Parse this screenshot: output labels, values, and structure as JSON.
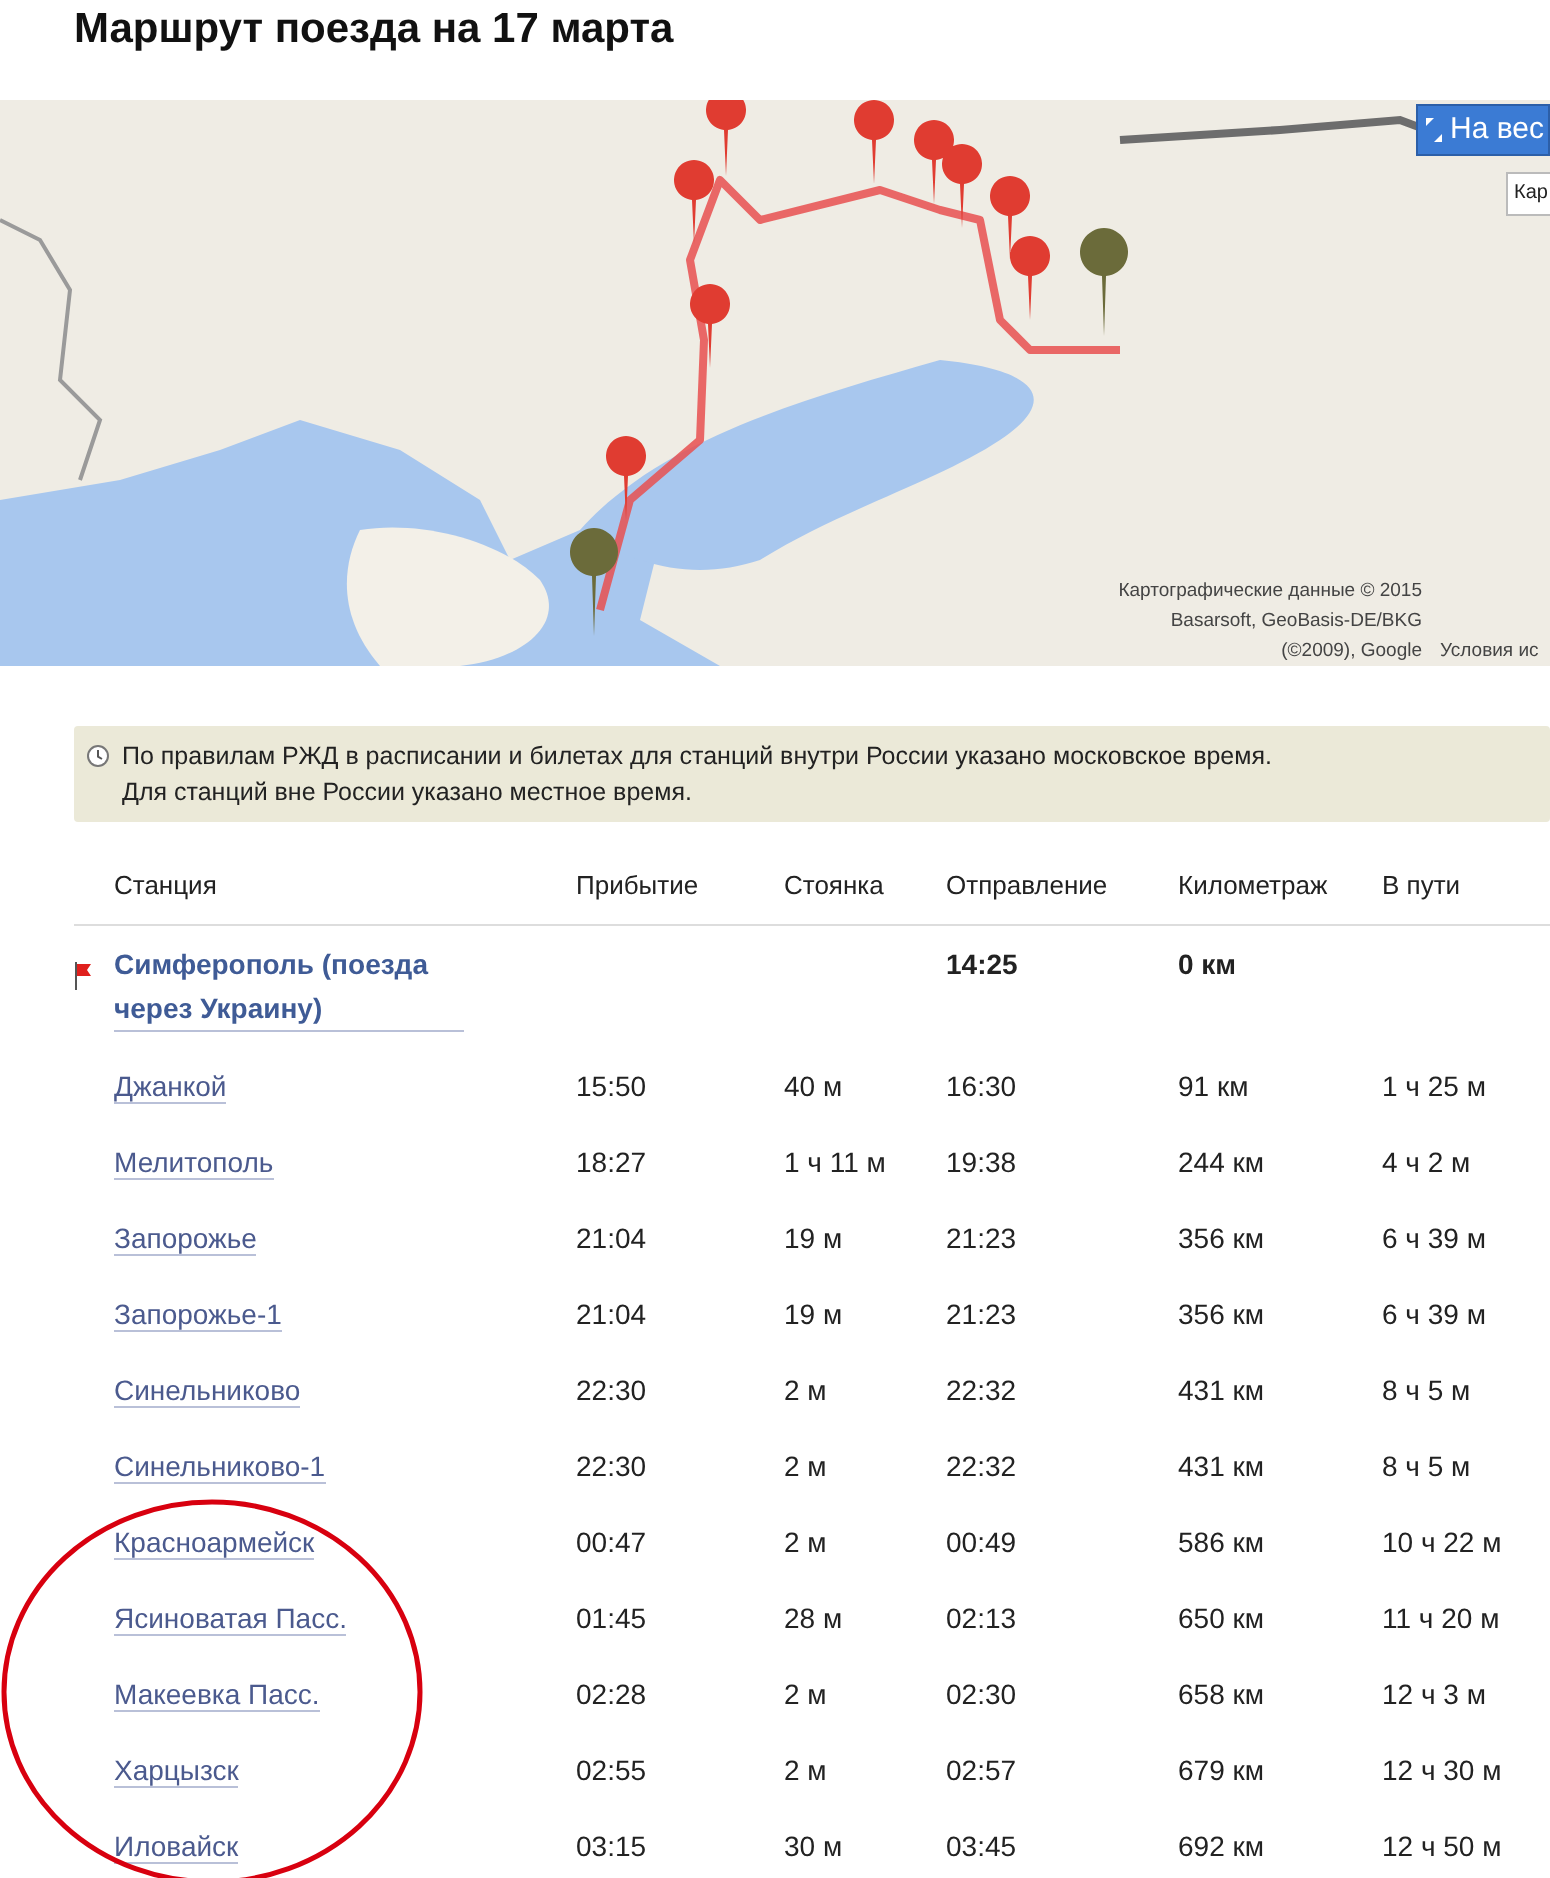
{
  "title": "Маршрут поезда на 17 марта",
  "map": {
    "kind": "picture",
    "fullscreen_button": "На вес",
    "map_type_button": "Кар",
    "attribution": [
      "Картографические данные © 2015",
      "Basarsoft, GeoBasis-DE/BKG",
      "(©2009), Google"
    ],
    "terms_link": "Условия ис"
  },
  "notice": [
    "По правилам РЖД в расписании и билетах для станций внутри России указано московское время.",
    "Для станций вне России указано местное время."
  ],
  "table": {
    "columns": [
      "Станция",
      "Прибытие",
      "Стоянка",
      "Отправление",
      "Километраж",
      "В пути"
    ],
    "rows": [
      {
        "kind": "origin",
        "station": "Симферополь (поезда через Украину)",
        "arrival": "",
        "stop": "",
        "departure": "14:25",
        "distance": "0 км",
        "travel": ""
      },
      {
        "kind": "stop",
        "station": "Джанкой",
        "arrival": "15:50",
        "stop": "40 м",
        "departure": "16:30",
        "distance": "91 км",
        "travel": "1 ч 25 м"
      },
      {
        "kind": "stop",
        "station": "Мелитополь",
        "arrival": "18:27",
        "stop": "1 ч 11 м",
        "departure": "19:38",
        "distance": "244 км",
        "travel": "4 ч 2 м"
      },
      {
        "kind": "stop",
        "station": "Запорожье",
        "arrival": "21:04",
        "stop": "19 м",
        "departure": "21:23",
        "distance": "356 км",
        "travel": "6 ч 39 м"
      },
      {
        "kind": "stop",
        "station": "Запорожье-1",
        "arrival": "21:04",
        "stop": "19 м",
        "departure": "21:23",
        "distance": "356 км",
        "travel": "6 ч 39 м"
      },
      {
        "kind": "stop",
        "station": "Синельниково",
        "arrival": "22:30",
        "stop": "2 м",
        "departure": "22:32",
        "distance": "431 км",
        "travel": "8 ч 5 м"
      },
      {
        "kind": "stop",
        "station": "Синельниково-1",
        "arrival": "22:30",
        "stop": "2 м",
        "departure": "22:32",
        "distance": "431 км",
        "travel": "8 ч 5 м"
      },
      {
        "kind": "stop",
        "station": "Красноармейск",
        "arrival": "00:47",
        "stop": "2 м",
        "departure": "00:49",
        "distance": "586 км",
        "travel": "10 ч 22 м"
      },
      {
        "kind": "stop",
        "station": "Ясиноватая Пасс.",
        "arrival": "01:45",
        "stop": "28 м",
        "departure": "02:13",
        "distance": "650 км",
        "travel": "11 ч 20 м"
      },
      {
        "kind": "stop",
        "station": "Макеевка Пасс.",
        "arrival": "02:28",
        "stop": "2 м",
        "departure": "02:30",
        "distance": "658 км",
        "travel": "12 ч 3 м"
      },
      {
        "kind": "stop",
        "station": "Харцызск",
        "arrival": "02:55",
        "stop": "2 м",
        "departure": "02:57",
        "distance": "679 км",
        "travel": "12 ч 30 м"
      },
      {
        "kind": "stop",
        "station": "Иловайск",
        "arrival": "03:15",
        "stop": "30 м",
        "departure": "03:45",
        "distance": "692 км",
        "travel": "12 ч 50 м"
      }
    ]
  },
  "annotations": [
    {
      "kind": "ellipse"
    }
  ]
}
